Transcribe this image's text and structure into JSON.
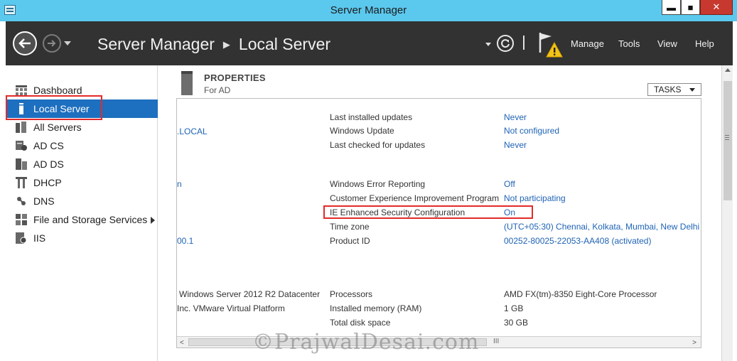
{
  "window": {
    "title": "Server Manager",
    "buttons": [
      "▬",
      "■",
      "✕"
    ]
  },
  "header": {
    "breadcrumb_root": "Server Manager",
    "breadcrumb_current": "Local Server",
    "menus": [
      "Manage",
      "Tools",
      "View",
      "Help"
    ]
  },
  "sidebar": {
    "items": [
      {
        "label": "Dashboard",
        "icon": "dashboard-icon"
      },
      {
        "label": "Local Server",
        "icon": "local-server-icon",
        "selected": true
      },
      {
        "label": "All Servers",
        "icon": "all-servers-icon"
      },
      {
        "label": "AD CS",
        "icon": "ad-cs-icon"
      },
      {
        "label": "AD DS",
        "icon": "ad-ds-icon"
      },
      {
        "label": "DHCP",
        "icon": "dhcp-icon"
      },
      {
        "label": "DNS",
        "icon": "dns-icon"
      },
      {
        "label": "File and Storage Services",
        "icon": "file-storage-icon",
        "has_submenu": true
      },
      {
        "label": "IIS",
        "icon": "iis-icon"
      }
    ]
  },
  "properties": {
    "title": "PROPERTIES",
    "subtitle": "For AD",
    "tasks_label": "TASKS",
    "left_fragments": [
      ".LOCAL",
      "n",
      "00.1",
      "Windows Server 2012 R2 Datacenter",
      "Inc. VMware Virtual Platform"
    ],
    "rows": [
      {
        "label": "Last installed updates",
        "value": "Never"
      },
      {
        "label": "Windows Update",
        "value": "Not configured"
      },
      {
        "label": "Last checked for updates",
        "value": "Never"
      },
      {
        "label": "Windows Error Reporting",
        "value": "Off"
      },
      {
        "label": "Customer Experience Improvement Program",
        "value": "Not participating"
      },
      {
        "label": "IE Enhanced Security Configuration",
        "value": "On"
      },
      {
        "label": "Time zone",
        "value": "(UTC+05:30) Chennai, Kolkata, Mumbai, New Delhi"
      },
      {
        "label": "Product ID",
        "value": "00252-80025-22053-AA408 (activated)"
      },
      {
        "label": "Processors",
        "value": "AMD FX(tm)-8350 Eight-Core Processor"
      },
      {
        "label": "Installed memory (RAM)",
        "value": "1 GB"
      },
      {
        "label": "Total disk space",
        "value": "30 GB"
      }
    ]
  },
  "scrollbar": {
    "grip": "III"
  },
  "watermark": "©PrajwalDesai.com",
  "colors": {
    "titlebar": "#5bc8ee",
    "header": "#323232",
    "selection": "#1d6fbf",
    "link": "#1f63b5",
    "highlight_box": "#e32a2a"
  }
}
